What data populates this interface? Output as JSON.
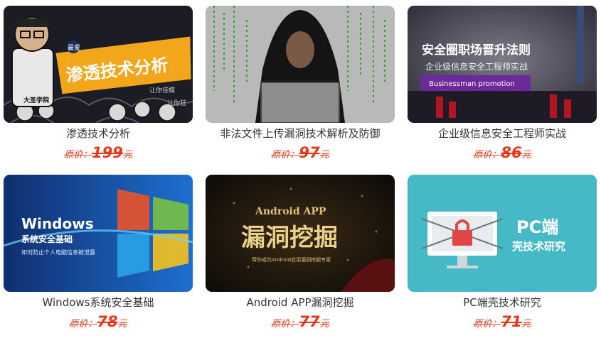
{
  "courses": [
    {
      "title": "渗透技术分析",
      "price_label": "原价：",
      "price": "199",
      "currency": "元",
      "banner": {
        "main": "渗透技术分析",
        "badge": "最爱",
        "note1": "让你佳模",
        "note2": "让你狂",
        "logo": "大圣学院"
      }
    },
    {
      "title": "非法文件上传漏洞技术解析及防御",
      "price_label": "原价：",
      "price": "97",
      "currency": "元",
      "banner": {}
    },
    {
      "title": "企业级信息安全工程师实战",
      "price_label": "原价：",
      "price": "86",
      "currency": "元",
      "banner": {
        "main": "安全圈职场晋升法则",
        "sub": "企业级信息安全工程师实战",
        "tag": "Businessman promotion"
      }
    },
    {
      "title": "Windows系统安全基础",
      "price_label": "原价：",
      "price": "78",
      "currency": "元",
      "banner": {
        "main": "Windows",
        "sub": "系统安全基础",
        "note": "如何防止个人电脑信息被泄露"
      }
    },
    {
      "title": "Android APP漏洞挖掘",
      "price_label": "原价：",
      "price": "77",
      "currency": "元",
      "banner": {
        "main": "Android APP",
        "sub": "漏洞挖掘",
        "note": "帮你成为Android应用漏洞挖掘专家"
      }
    },
    {
      "title": "PC端壳技术研究",
      "price_label": "原价：",
      "price": "71",
      "currency": "元",
      "banner": {
        "main": "PC端",
        "sub": "壳技术研究"
      }
    }
  ],
  "colors": {
    "price": "#e4391b",
    "title": "#333333"
  }
}
